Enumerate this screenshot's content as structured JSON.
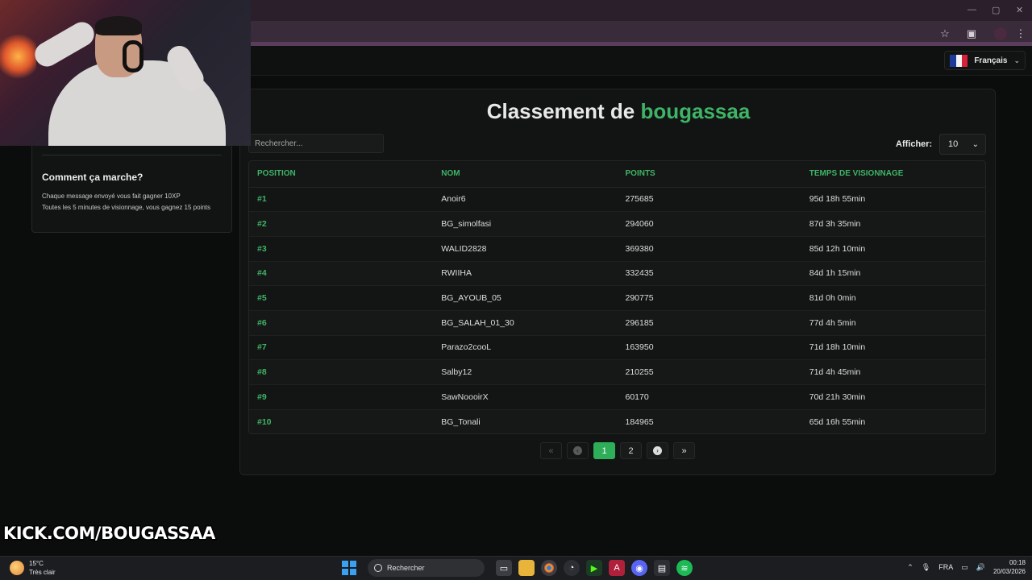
{
  "browser": {
    "window_controls": [
      "—",
      "▢",
      "✕"
    ],
    "toolbar_icons": [
      "star-icon",
      "extensions-icon",
      "profile-icon",
      "menu-icon"
    ]
  },
  "header": {
    "language": "Français"
  },
  "sidebar": {
    "title": "Comment ça marche?",
    "line1": "Chaque message envoyé vous fait gagner 10XP",
    "line2": "Toutes les 5 minutes de visionnage, vous gagnez 15 points"
  },
  "leaderboard": {
    "title_prefix": "Classement de ",
    "title_name": "bougassaa",
    "search_placeholder": "Rechercher...",
    "show_label": "Afficher:",
    "show_value": "10",
    "columns": [
      "POSITION",
      "NOM",
      "POINTS",
      "TEMPS DE VISIONNAGE"
    ],
    "rows": [
      {
        "pos": "#1",
        "name": "Anoir6",
        "points": "275685",
        "time": "95d 18h 55min"
      },
      {
        "pos": "#2",
        "name": "BG_simolfasi",
        "points": "294060",
        "time": "87d 3h 35min"
      },
      {
        "pos": "#3",
        "name": "WALID2828",
        "points": "369380",
        "time": "85d 12h 10min"
      },
      {
        "pos": "#4",
        "name": "RWIIHA",
        "points": "332435",
        "time": "84d 1h 15min"
      },
      {
        "pos": "#5",
        "name": "BG_AYOUB_05",
        "points": "290775",
        "time": "81d 0h 0min"
      },
      {
        "pos": "#6",
        "name": "BG_SALAH_01_30",
        "points": "296185",
        "time": "77d 4h 5min"
      },
      {
        "pos": "#7",
        "name": "Parazo2cooL",
        "points": "163950",
        "time": "71d 18h 10min"
      },
      {
        "pos": "#8",
        "name": "Salby12",
        "points": "210255",
        "time": "71d 4h 45min"
      },
      {
        "pos": "#9",
        "name": "SawNoooirX",
        "points": "60170",
        "time": "70d 21h 30min"
      },
      {
        "pos": "#10",
        "name": "BG_Tonali",
        "points": "184965",
        "time": "65d 16h 55min"
      }
    ],
    "pagination": {
      "first": "«",
      "page1": "1",
      "page2": "2",
      "last": "»"
    }
  },
  "overlay": {
    "kick_text": "KICK.COM/BOUGASSAA"
  },
  "taskbar": {
    "temperature": "15°C",
    "weather": "Très clair",
    "search_label": "Rechercher",
    "language": "FRA",
    "time": "00:18",
    "date": "20/03/2026"
  },
  "colors": {
    "accent": "#3fb467",
    "active_page": "#2fae5a",
    "kick_green": "#53fc18"
  }
}
